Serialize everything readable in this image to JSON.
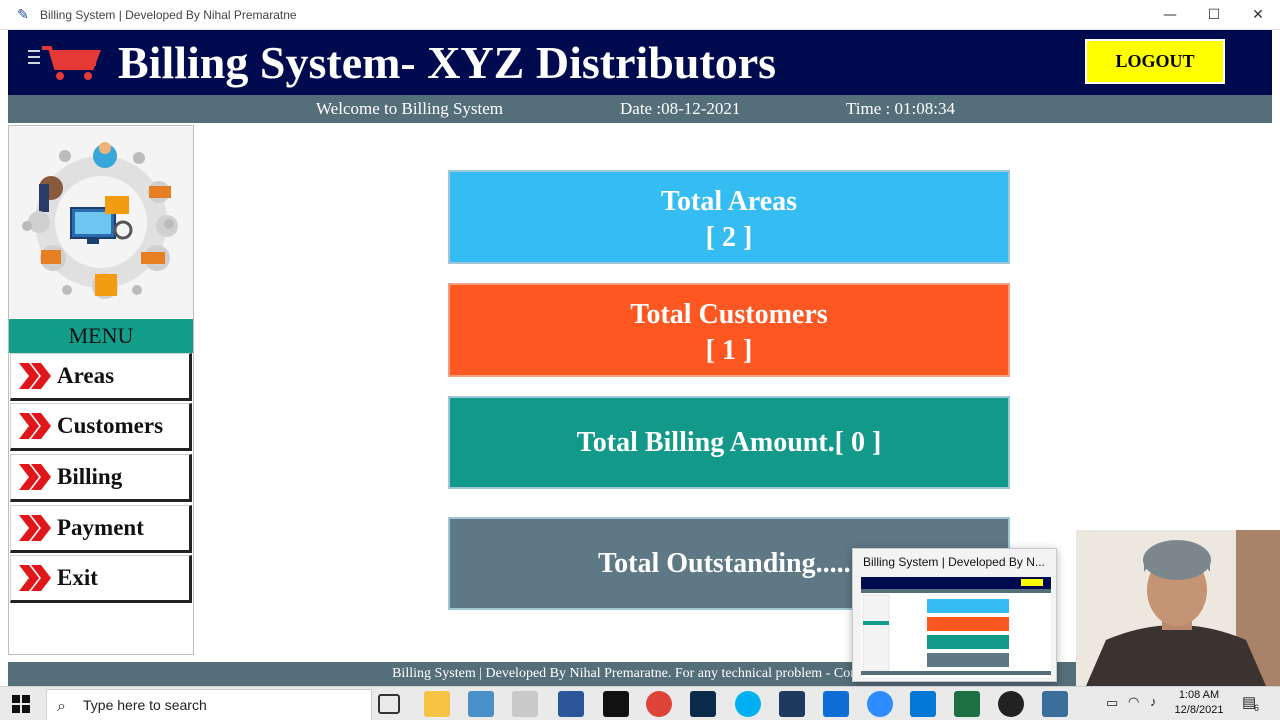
{
  "window": {
    "title": "Billing System | Developed By Nihal Premaratne",
    "minimize": "—",
    "maximize": "☐",
    "close": "✕"
  },
  "header": {
    "title": "Billing System- XYZ Distributors",
    "logout_label": "LOGOUT",
    "icon": "cart-icon",
    "colors": {
      "background": "#000a4f",
      "logout": "#ffff00"
    }
  },
  "info_bar": {
    "welcome": "Welcome to Billing System",
    "date": "Date :08-12-2021",
    "time": "Time : 01:08:34"
  },
  "sidebar": {
    "menu_label": "MENU",
    "items": [
      {
        "label": "Areas",
        "icon": "double-chevron-right-icon"
      },
      {
        "label": "Customers",
        "icon": "double-chevron-right-icon"
      },
      {
        "label": "Billing",
        "icon": "double-chevron-right-icon"
      },
      {
        "label": "Payment",
        "icon": "double-chevron-right-icon"
      },
      {
        "label": "Exit",
        "icon": "double-chevron-right-icon"
      }
    ]
  },
  "cards": {
    "areas": {
      "title": "Total Areas",
      "value": "[ 2 ]",
      "color": "#35bcf2"
    },
    "customers": {
      "title": "Total Customers",
      "value": "[ 1 ]",
      "color": "#ff5722"
    },
    "billing": {
      "title": "Total Billing Amount.[ 0 ]",
      "color": "#13998a"
    },
    "outstanding": {
      "title": "Total Outstanding.....[",
      "color": "#5f7886"
    }
  },
  "footer": {
    "text": "Billing System | Developed By Nihal Premaratne. For any technical problem - Contact 0"
  },
  "preview": {
    "title": "Billing System | Developed By N..."
  },
  "taskbar": {
    "search_placeholder": "Type here to search",
    "time": "1:08 AM",
    "date": "12/8/2021",
    "notification_count": "6"
  }
}
